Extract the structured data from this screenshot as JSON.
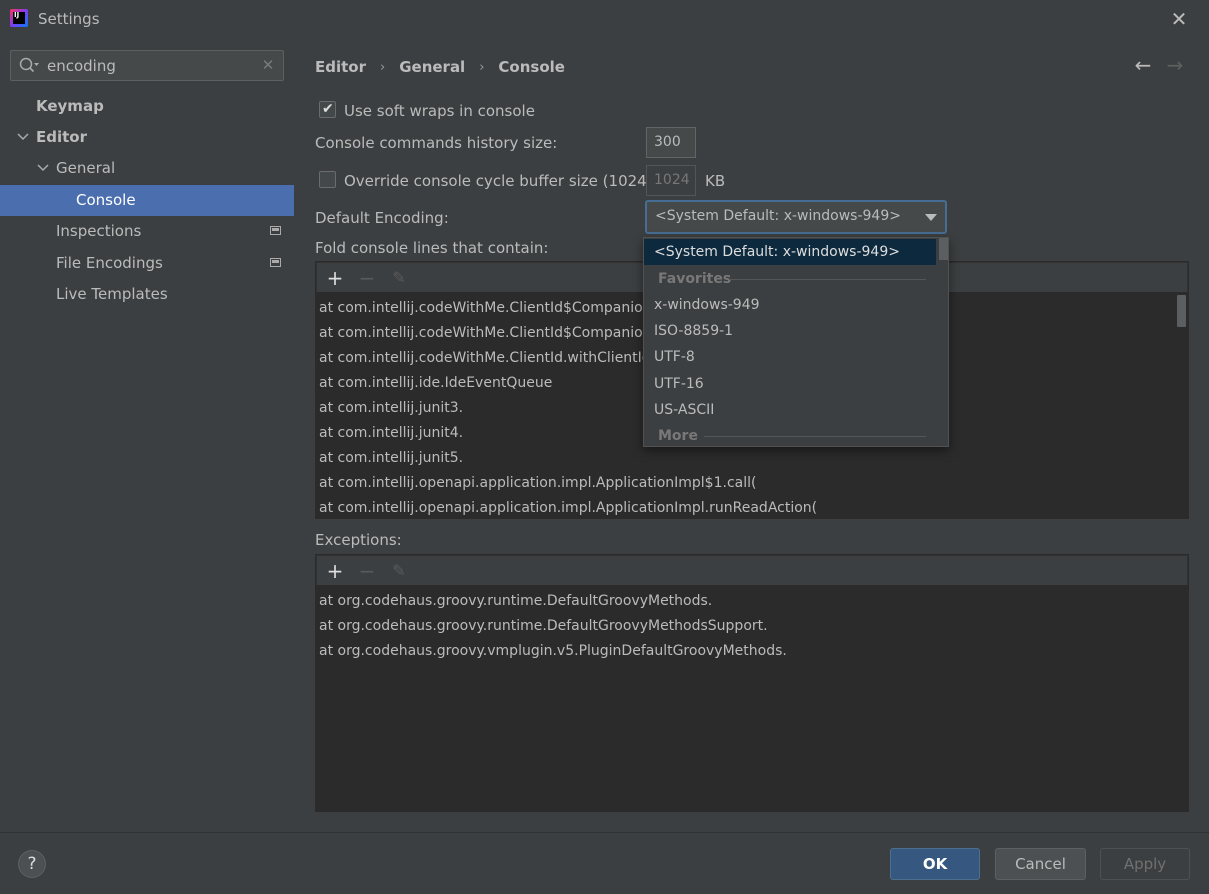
{
  "window": {
    "title": "Settings",
    "close_glyph": "✕",
    "icon_letters": "IJ"
  },
  "sidebar": {
    "search": {
      "value": "encoding",
      "clear_glyph": "✕"
    },
    "items": [
      {
        "label": "Keymap"
      },
      {
        "label": "Editor"
      },
      {
        "label": "General"
      },
      {
        "label": "Console"
      },
      {
        "label": "Inspections"
      },
      {
        "label": "File Encodings"
      },
      {
        "label": "Live Templates"
      }
    ]
  },
  "breadcrumb": {
    "items": [
      "Editor",
      "General",
      "Console"
    ],
    "separator": "›"
  },
  "nav": {
    "back_glyph": "←",
    "forward_glyph": "→"
  },
  "settings": {
    "soft_wraps_label": "Use soft wraps in console",
    "soft_wraps_checked": true,
    "history_label": "Console commands history size:",
    "history_value": "300",
    "override_label": "Override console cycle buffer size (1024 KB)",
    "override_checked": false,
    "override_value": "1024",
    "override_unit": "KB",
    "encoding_label": "Default Encoding:",
    "encoding_value": "<System Default: x-windows-949>",
    "fold_label": "Fold console lines that contain:",
    "exceptions_label": "Exceptions:"
  },
  "toolbar": {
    "add": "+",
    "remove": "−",
    "edit": "✎"
  },
  "fold_lines": [
    "at com.intellij.codeWithMe.ClientId$Companion",
    "at com.intellij.codeWithMe.ClientId$Companion",
    "at com.intellij.codeWithMe.ClientId.withClientId",
    "at com.intellij.ide.IdeEventQueue",
    "at com.intellij.junit3.",
    "at com.intellij.junit4.",
    "at com.intellij.junit5.",
    "at com.intellij.openapi.application.impl.ApplicationImpl$1.call(",
    "at com.intellij.openapi.application.impl.ApplicationImpl.runReadAction("
  ],
  "exception_lines": [
    "at org.codehaus.groovy.runtime.DefaultGroovyMethods.",
    "at org.codehaus.groovy.runtime.DefaultGroovyMethodsSupport.",
    "at org.codehaus.groovy.vmplugin.v5.PluginDefaultGroovyMethods."
  ],
  "dropdown": {
    "selected": "<System Default: x-windows-949>",
    "favorites_header": "Favorites",
    "favorites": [
      "x-windows-949",
      "ISO-8859-1",
      "UTF-8",
      "UTF-16",
      "US-ASCII"
    ],
    "more_header": "More"
  },
  "footer": {
    "help": "?",
    "ok": "OK",
    "cancel": "Cancel",
    "apply": "Apply"
  },
  "colors": {
    "selection": "#4b6eaf",
    "ok_button": "#365880",
    "focus_border": "#466d94",
    "dropdown_selected": "#0d293e"
  }
}
